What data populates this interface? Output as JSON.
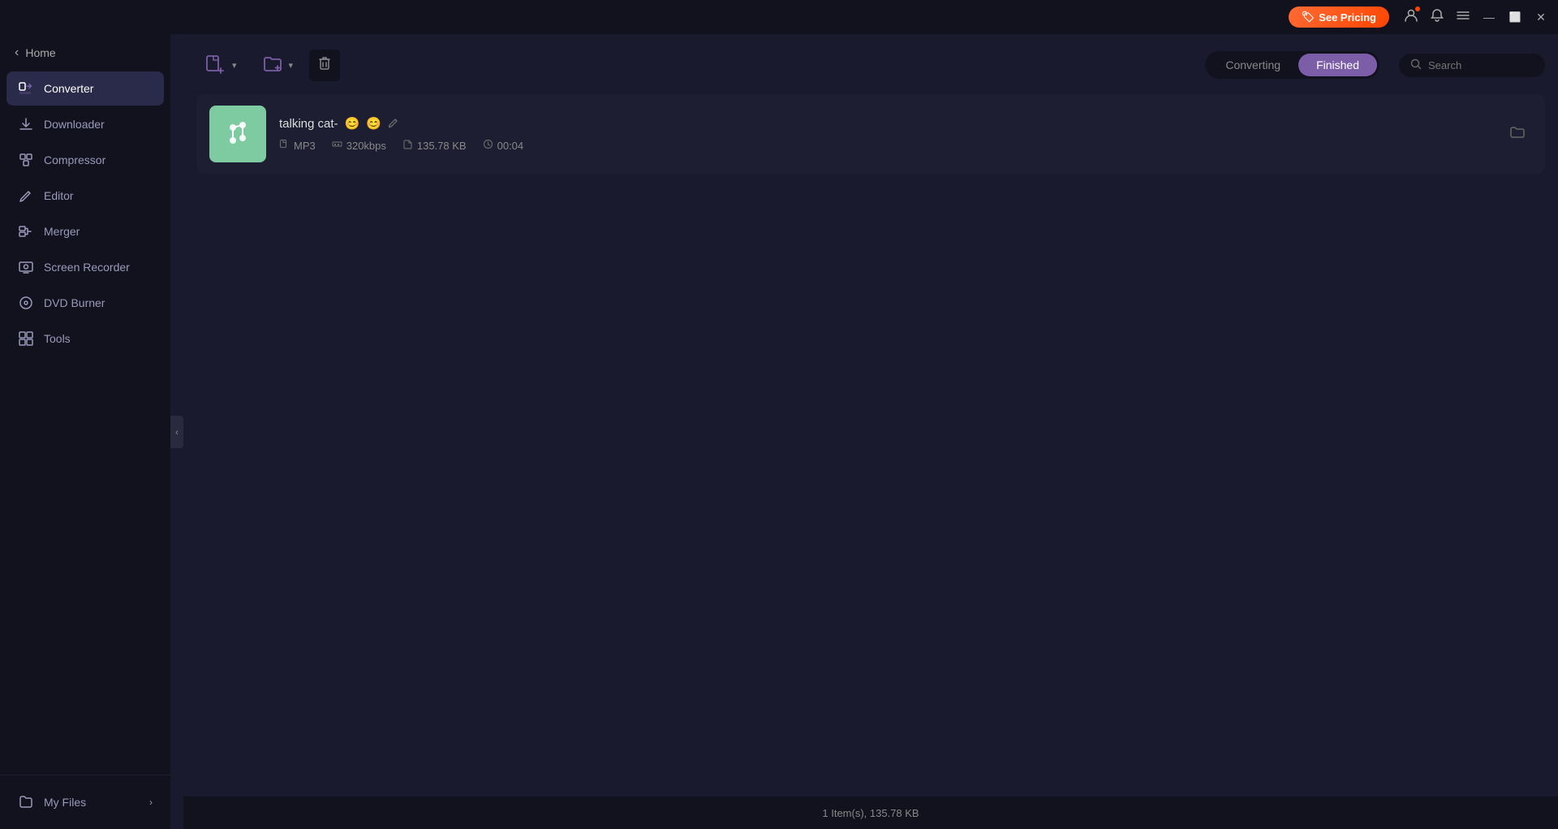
{
  "titleBar": {
    "seePricingLabel": "See Pricing",
    "seePricingIcon": "🏷",
    "userIcon": "👤",
    "notificationIcon": "🔔",
    "menuIcon": "☰",
    "minimizeIcon": "—",
    "maximizeIcon": "⬜",
    "closeIcon": "✕"
  },
  "sidebar": {
    "homeLabel": "Home",
    "homeChevron": "‹",
    "items": [
      {
        "id": "converter",
        "label": "Converter",
        "icon": "converter",
        "active": true
      },
      {
        "id": "downloader",
        "label": "Downloader",
        "icon": "downloader",
        "active": false
      },
      {
        "id": "compressor",
        "label": "Compressor",
        "icon": "compressor",
        "active": false
      },
      {
        "id": "editor",
        "label": "Editor",
        "icon": "editor",
        "active": false
      },
      {
        "id": "merger",
        "label": "Merger",
        "icon": "merger",
        "active": false
      },
      {
        "id": "screen-recorder",
        "label": "Screen Recorder",
        "icon": "screen-recorder",
        "active": false
      },
      {
        "id": "dvd-burner",
        "label": "DVD Burner",
        "icon": "dvd-burner",
        "active": false
      },
      {
        "id": "tools",
        "label": "Tools",
        "icon": "tools",
        "active": false
      }
    ],
    "myFilesLabel": "My Files",
    "myFilesArrow": "›",
    "collapseIcon": "‹"
  },
  "toolbar": {
    "addFileLabel": "add-file",
    "addFileDropdown": "▾",
    "addFolderLabel": "add-folder",
    "addFolderDropdown": "▾",
    "clearAllIcon": "🗑",
    "tabs": [
      {
        "id": "converting",
        "label": "Converting",
        "active": false
      },
      {
        "id": "finished",
        "label": "Finished",
        "active": true
      }
    ],
    "searchPlaceholder": "Search"
  },
  "fileList": {
    "items": [
      {
        "id": "file-1",
        "name": "talking cat-",
        "emoji1": "😊",
        "emoji2": "😊",
        "format": "MP3",
        "bitrate": "320kbps",
        "filesize": "135.78 KB",
        "duration": "00:04",
        "thumbnail": "♪"
      }
    ]
  },
  "statusBar": {
    "text": "1 Item(s), 135.78 KB"
  }
}
